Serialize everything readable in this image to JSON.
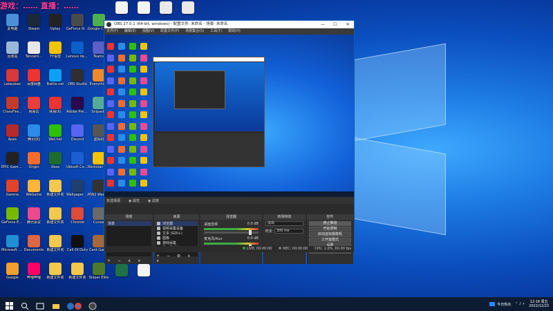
{
  "overlay_text": "游戏：……   直播：……",
  "desktop": {
    "column1": [
      {
        "label": "此电脑",
        "icon": "computer-icon",
        "color": "#4a90d9"
      },
      {
        "label": "回收站",
        "icon": "recycle-bin-icon",
        "color": "#9ab8d8"
      },
      {
        "label": "Leiwubao",
        "icon": "app-icon",
        "color": "#d83a3a"
      },
      {
        "label": "CrossFire...",
        "icon": "game-icon",
        "color": "#c23b2c"
      },
      {
        "label": "Apex",
        "icon": "game-icon",
        "color": "#b52a2a"
      },
      {
        "label": "EPIC Games Launcher",
        "icon": "epic-icon",
        "color": "#222222"
      },
      {
        "label": "Garena",
        "icon": "app-icon",
        "color": "#e2442a"
      },
      {
        "label": "GeForce Experience",
        "icon": "nvidia-icon",
        "color": "#76b900"
      },
      {
        "label": "Microsoft Edge",
        "icon": "edge-icon",
        "color": "#1f8fd4"
      },
      {
        "label": "Google",
        "icon": "app-icon",
        "color": "#f0a030"
      }
    ],
    "column2": [
      {
        "label": "Steam",
        "icon": "steam-icon",
        "color": "#1b2838"
      },
      {
        "label": "Tencent...",
        "icon": "app-icon",
        "color": "#e8e8e8"
      },
      {
        "label": "百度网盘",
        "icon": "app-icon",
        "color": "#e33"
      },
      {
        "label": "网易云",
        "icon": "music-icon",
        "color": "#ea3e3e"
      },
      {
        "label": "腾讯QQ",
        "icon": "qq-icon",
        "color": "#2b8be8"
      },
      {
        "label": "Origin",
        "icon": "origin-icon",
        "color": "#f56c2d"
      },
      {
        "label": "WeGame",
        "icon": "app-icon",
        "color": "#ffb43a"
      },
      {
        "label": "腾讯会议",
        "icon": "app-icon",
        "color": "#ec4a8e"
      },
      {
        "label": "Documents",
        "icon": "app-icon",
        "color": "#d64"
      },
      {
        "label": "哔哩哔哩",
        "icon": "app-icon",
        "color": "#f06"
      }
    ],
    "column3": [
      {
        "label": "Uplay",
        "icon": "app-icon",
        "color": "#222"
      },
      {
        "label": "YY语音",
        "icon": "app-icon",
        "color": "#f5c400"
      },
      {
        "label": "Battle.net",
        "icon": "app-icon",
        "color": "#0da1f5"
      },
      {
        "label": "网易UU",
        "icon": "app-icon",
        "color": "#e33"
      },
      {
        "label": "WeChat",
        "icon": "wechat-icon",
        "color": "#2dc100"
      },
      {
        "label": "Xbox",
        "icon": "app-icon",
        "color": "#1e6b2e"
      },
      {
        "label": "新建文件夹",
        "icon": "folder-icon",
        "color": "#f2c94c"
      },
      {
        "label": "新建文件夹",
        "icon": "folder-icon",
        "color": "#f2c94c"
      },
      {
        "label": "新建文件夹",
        "icon": "folder-icon",
        "color": "#f2c94c"
      },
      {
        "label": "新建文件夹",
        "icon": "folder-icon",
        "color": "#f2c94c"
      }
    ],
    "column4": [
      {
        "label": "GeForce Now",
        "icon": "app-icon",
        "color": "#4a4a4a"
      },
      {
        "label": "Lenovo Vantage",
        "icon": "app-icon",
        "color": "#0a5fc8"
      },
      {
        "label": "OBS Studio",
        "icon": "obs-icon",
        "color": "#302e31"
      },
      {
        "label": "Adobe Premiere",
        "icon": "premiere-icon",
        "color": "#2a0a4a"
      },
      {
        "label": "Discord",
        "icon": "app-icon",
        "color": "#5865f2"
      },
      {
        "label": "Ubisoft Connect",
        "icon": "app-icon",
        "color": "#1a5fd1"
      },
      {
        "label": "Wallpaper Engine",
        "icon": "app-icon",
        "color": "#1f3f6e"
      },
      {
        "label": "Chrome",
        "icon": "chrome-icon",
        "color": "#dd4b39"
      },
      {
        "label": "Call Of Duty",
        "icon": "app-icon",
        "color": "#111"
      },
      {
        "label": "新建文件夹",
        "icon": "folder-icon",
        "color": "#f2c94c"
      }
    ],
    "column5": [
      {
        "label": "Google Chrome",
        "icon": "chrome-icon",
        "color": "#4caf50"
      },
      {
        "label": "Teams",
        "icon": "app-icon",
        "color": "#5b5fc7"
      },
      {
        "label": "Everything",
        "icon": "app-icon",
        "color": "#ee8a2b"
      },
      {
        "label": "Snipaste",
        "icon": "app-icon",
        "color": "#5a9"
      },
      {
        "label": "虚拟机",
        "icon": "app-icon",
        "color": "#555"
      },
      {
        "label": "Rockstar Games",
        "icon": "app-icon",
        "color": "#f5c400"
      },
      {
        "label": "MW2 Warzone",
        "icon": "app-icon",
        "color": "#333"
      },
      {
        "label": "Cursor",
        "icon": "app-icon",
        "color": "#6a6a6a"
      },
      {
        "label": "Card Game",
        "icon": "app-icon",
        "color": "#a5683c"
      },
      {
        "label": "Sniper Elite",
        "icon": "app-icon",
        "color": "#4c7a2a"
      }
    ],
    "top_row": [
      {
        "label": "",
        "icon": "document-icon",
        "color": "#f4f4f4"
      },
      {
        "label": "",
        "icon": "document-icon",
        "color": "#f4f4f4"
      },
      {
        "label": "",
        "icon": "image-icon",
        "color": "#e9e9e9"
      },
      {
        "label": "",
        "icon": "document-icon",
        "color": "#e9e9e9"
      }
    ],
    "bottom_row": [
      {
        "label": "",
        "icon": "excel-icon",
        "color": "#1f7244"
      },
      {
        "label": "",
        "icon": "document-icon",
        "color": "#f4f4f4"
      }
    ]
  },
  "obs": {
    "title": "OBS 27.0.1 (64-bit, windows) - 配置文件: 未命名 - 场景: 未命名",
    "window_controls": [
      "—",
      "☐",
      "✕"
    ],
    "menu": [
      "文件(F)",
      "编辑(E)",
      "视图(V)",
      "配置文件(P)",
      "场景集合(S)",
      "工具(T)",
      "帮助(H)"
    ],
    "status_row": [
      "未选择源",
      "◉ 属性",
      "◉ 滤镜"
    ],
    "docks": {
      "scenes": {
        "title": "场景",
        "items": [
          "场景"
        ],
        "footer": "+ − ∧ ∨"
      },
      "sources": {
        "title": "来源",
        "items": [
          "浏览器",
          "视频采集设备",
          "文本 (GDI+)",
          "图像",
          "游戏采集",
          "显示器采集"
        ],
        "footer": "+ − ⚙ ∧ ∨"
      },
      "mixer": {
        "title": "混音器",
        "tracks": [
          {
            "name": "桌面音频",
            "db": "0.0 dB"
          },
          {
            "name": "麦克风/Aux",
            "db": "0.0 dB"
          }
        ]
      },
      "transitions": {
        "title": "转场特效",
        "type": "淡出",
        "duration_label": "时长",
        "duration": "300 ms"
      },
      "controls": {
        "title": "控件",
        "buttons": [
          "停止推流",
          "开始录制",
          "启动虚拟摄像机",
          "工作室模式",
          "设置",
          "退出"
        ]
      }
    },
    "statusbar": {
      "live": "LIVE: 00:00:00",
      "rec": "REC: 00:00:00",
      "cpu": "CPU: 1.0%, 60.00 fps"
    }
  },
  "taskbar": {
    "weather": "今日热点",
    "time": "12:18 周五",
    "date": "2022/12/23"
  }
}
